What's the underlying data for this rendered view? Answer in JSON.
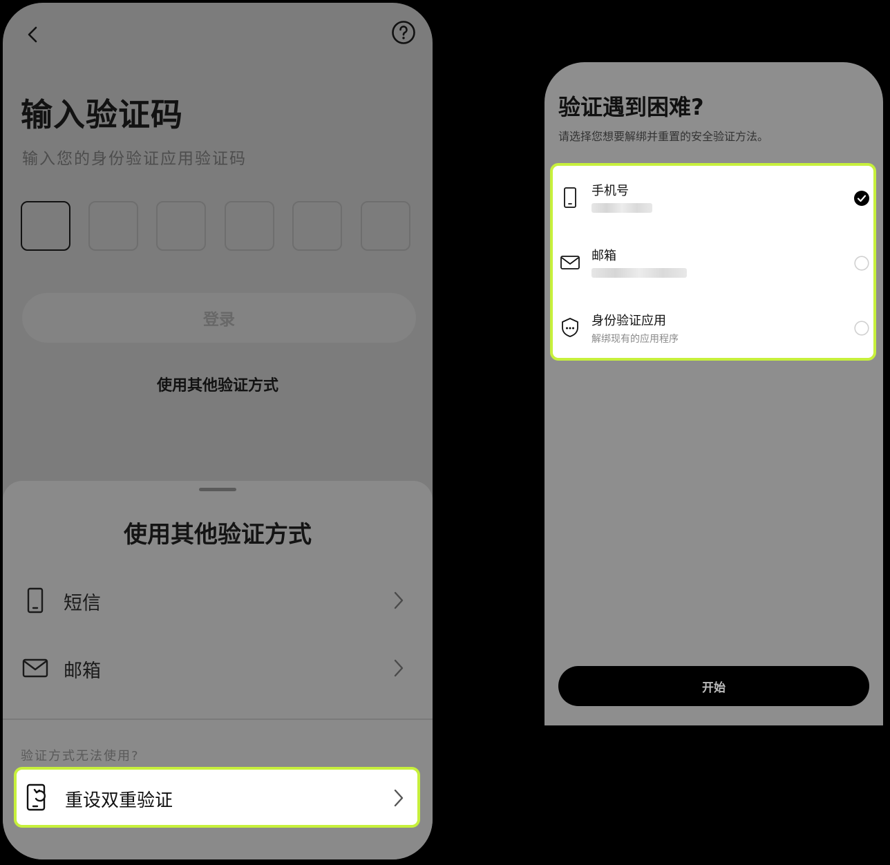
{
  "left_screen": {
    "title": "输入验证码",
    "subtitle": "输入您的身份验证应用验证码",
    "login_label": "登录",
    "other_method_link": "使用其他验证方式",
    "icons": {
      "back": "chevron-left-icon",
      "help": "help-circle-icon"
    }
  },
  "sheet": {
    "title": "使用其他验证方式",
    "items": [
      {
        "label": "短信",
        "icon": "phone-icon"
      },
      {
        "label": "邮箱",
        "icon": "mail-icon"
      }
    ],
    "hint": "验证方式无法使用?",
    "reset": {
      "label": "重设双重验证",
      "icon": "reset-device-icon"
    }
  },
  "right_screen": {
    "title": "验证遇到困难?",
    "subtitle": "请选择您想要解绑并重置的安全验证方法。",
    "options": [
      {
        "name": "手机号",
        "icon": "phone-icon",
        "selected": true
      },
      {
        "name": "邮箱",
        "icon": "mail-icon",
        "selected": false
      },
      {
        "name": "身份验证应用",
        "sub": "解绑现有的应用程序",
        "icon": "shield-password-icon",
        "selected": false
      }
    ],
    "start_label": "开始"
  },
  "colors": {
    "highlight": "#c7f03c",
    "overlay_gray": "#7c7c7c",
    "button_black": "#000000"
  }
}
